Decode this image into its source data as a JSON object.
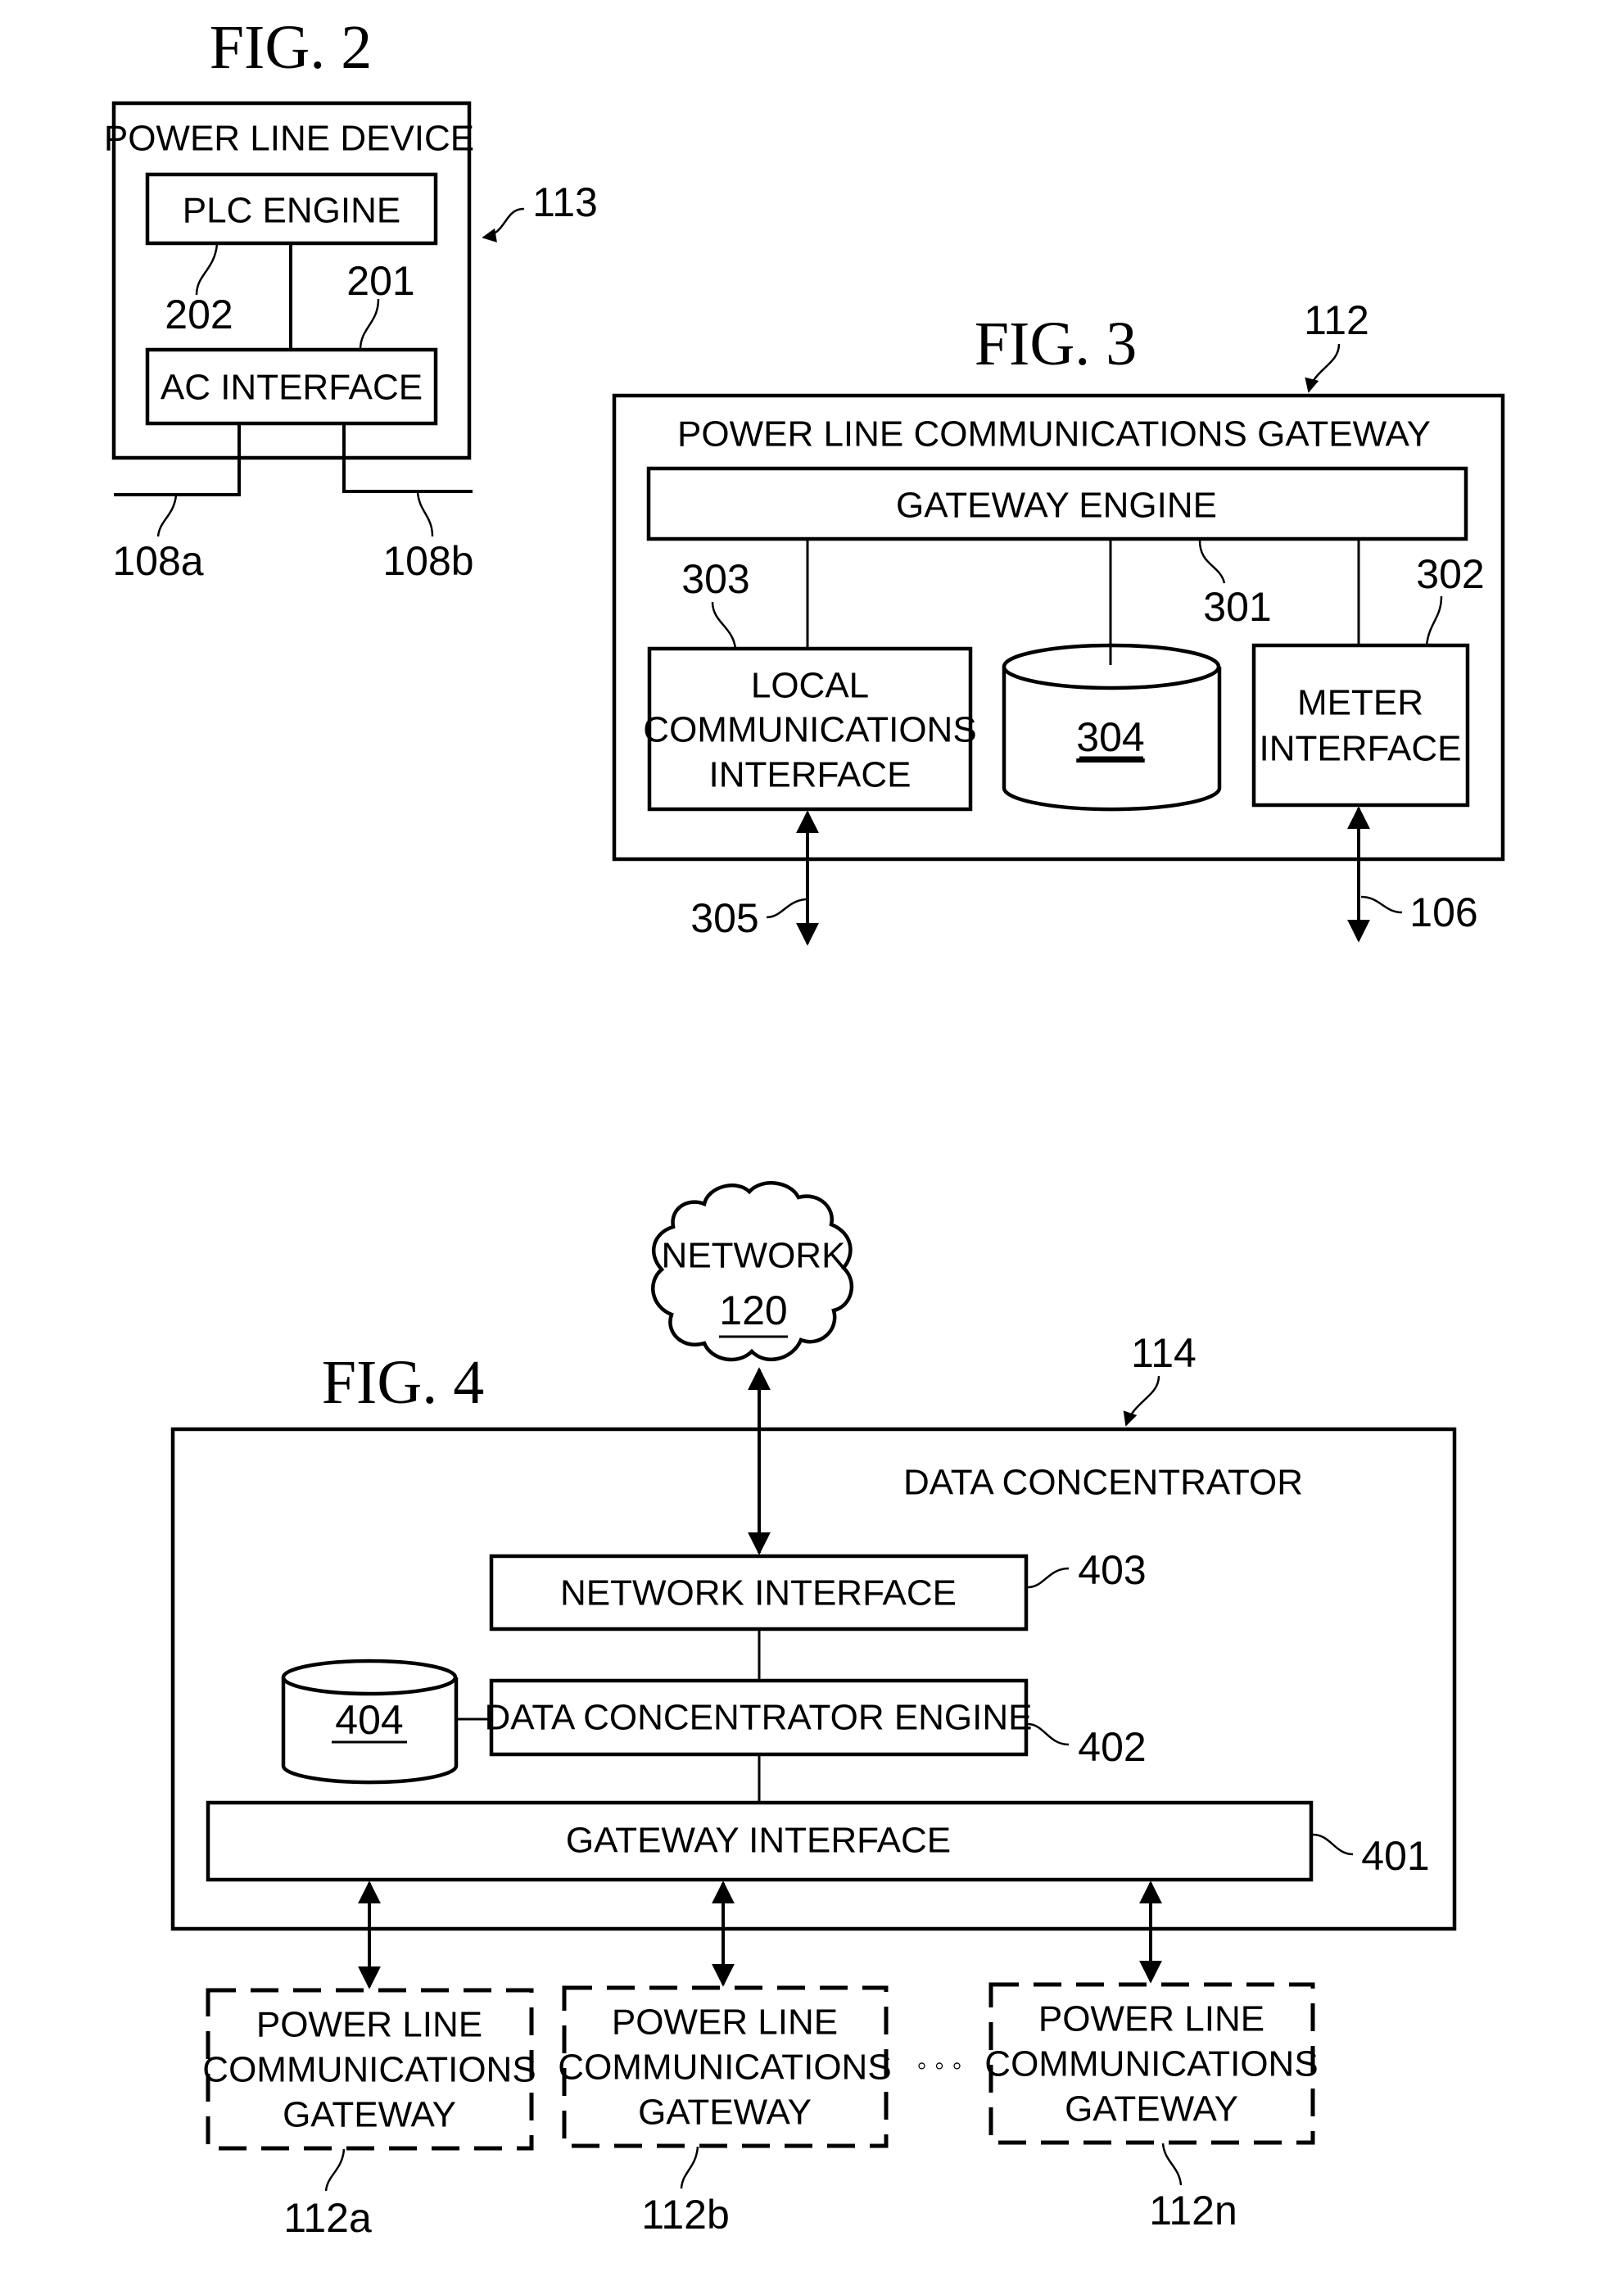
{
  "fig2": {
    "title": "FIG. 2",
    "device_label": "POWER LINE DEVICE",
    "ref_device": "113",
    "plc_engine": "PLC ENGINE",
    "ref_plc_engine": "202",
    "ac_interface": "AC INTERFACE",
    "ref_ac_interface": "201",
    "ref_line_a": "108a",
    "ref_line_b": "108b"
  },
  "fig3": {
    "title": "FIG. 3",
    "ref_gateway": "112",
    "gateway_label": "POWER LINE COMMUNICATIONS GATEWAY",
    "gateway_engine": "GATEWAY ENGINE",
    "ref_gateway_engine": "301",
    "local_comms": [
      "LOCAL",
      "COMMUNICATIONS",
      "INTERFACE"
    ],
    "ref_local_comms": "303",
    "storage": "304",
    "meter_interface": [
      "METER",
      "INTERFACE"
    ],
    "ref_meter_interface": "302",
    "ref_local_link": "305",
    "ref_meter_link": "106"
  },
  "fig4": {
    "title": "FIG. 4",
    "network": "NETWORK",
    "network_ref": "120",
    "ref_concentrator": "114",
    "concentrator_label": "DATA CONCENTRATOR",
    "network_interface": "NETWORK INTERFACE",
    "ref_network_interface": "403",
    "engine": "DATA CONCENTRATOR ENGINE",
    "ref_engine": "402",
    "storage": "404",
    "gateway_interface": "GATEWAY INTERFACE",
    "ref_gateway_interface": "401",
    "gateways": [
      {
        "lines": [
          "POWER LINE",
          "COMMUNICATIONS",
          "GATEWAY"
        ],
        "ref": "112a"
      },
      {
        "lines": [
          "POWER LINE",
          "COMMUNICATIONS",
          "GATEWAY"
        ],
        "ref": "112b"
      },
      {
        "lines": [
          "POWER LINE",
          "COMMUNICATIONS",
          "GATEWAY"
        ],
        "ref": "112n"
      }
    ],
    "ellipsis": "◦ ◦ ◦"
  }
}
